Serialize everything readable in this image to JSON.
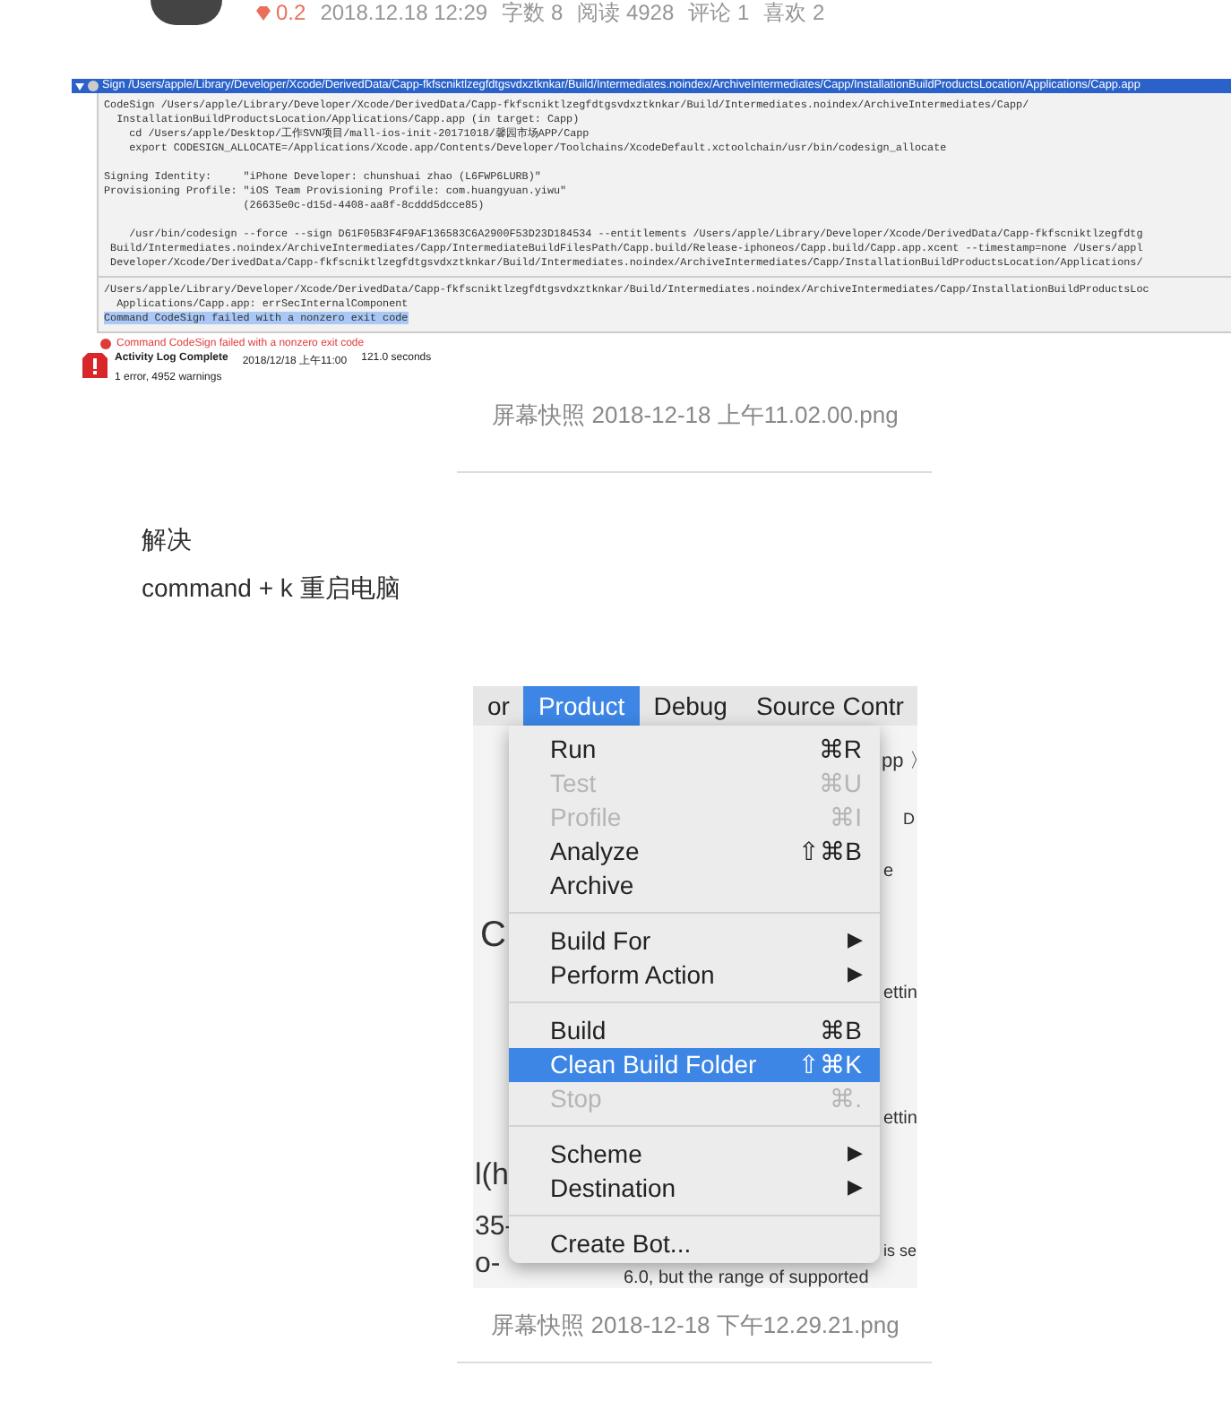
{
  "meta": {
    "score": "0.2",
    "date": "2018.12.18 12:29",
    "stats": [
      "字数 8",
      "阅读 4928",
      "评论 1",
      "喜欢 2"
    ]
  },
  "shot1": {
    "header": "Sign /Users/apple/Library/Developer/Xcode/DerivedData/Capp-fkfscniktlzegfdtgsvdxztknkar/Build/Intermediates.noindex/ArchiveIntermediates/Capp/InstallationBuildProductsLocation/Applications/Capp.app",
    "blocks": [
      [
        [
          "CodeSign /Users/apple/Library/Developer/Xcode/DerivedData/Capp-fkfscniktlzegfdtgsvdxztknkar/Build/Intermediates.noindex/ArchiveIntermediates/Capp/",
          "  InstallationBuildProductsLocation/Applications/Capp.app (in target: Capp)",
          "    cd /Users/apple/Desktop/工作SVN项目/mall-ios-init-20171018/馨园市场APP/Capp",
          "    export CODESIGN_ALLOCATE=/Applications/Xcode.app/Contents/Developer/Toolchains/XcodeDefault.xctoolchain/usr/bin/codesign_allocate"
        ],
        [
          "Signing Identity:     \"iPhone Developer: chunshuai zhao (L6FWP6LURB)\"",
          "Provisioning Profile: \"iOS Team Provisioning Profile: com.huangyuan.yiwu\"",
          "                      (26635e0c-d15d-4408-aa8f-8cddd5dcce85)"
        ],
        [
          "    /usr/bin/codesign --force --sign D61F05B3F4F9AF136583C6A2900F53D23D184534 --entitlements /Users/apple/Library/Developer/Xcode/DerivedData/Capp-fkfscniktlzegfdtg",
          " Build/Intermediates.noindex/ArchiveIntermediates/Capp/IntermediateBuildFilesPath/Capp.build/Release-iphoneos/Capp.build/Capp.app.xcent --timestamp=none /Users/appl",
          " Developer/Xcode/DerivedData/Capp-fkfscniktlzegfdtgsvdxztknkar/Build/Intermediates.noindex/ArchiveIntermediates/Capp/InstallationBuildProductsLocation/Applications/"
        ]
      ],
      [
        [
          "/Users/apple/Library/Developer/Xcode/DerivedData/Capp-fkfscniktlzegfdtgsvdxztknkar/Build/Intermediates.noindex/ArchiveIntermediates/Capp/InstallationBuildProductsLoc",
          "  Applications/Capp.app: errSecInternalComponent"
        ]
      ]
    ],
    "highlight": "Command CodeSign failed with a nonzero exit code",
    "error": "Command CodeSign failed with a nonzero exit code",
    "activity": {
      "title": "Activity Log Complete",
      "time": "2018/12/18 上午11:00",
      "duration": "121.0 seconds",
      "counts": "1 error, 4952 warnings"
    }
  },
  "caption1": "屏幕快照 2018-12-18 上午11.02.00.png",
  "solution": [
    "解决",
    "command + k 重启电脑"
  ],
  "shot2": {
    "menubar": [
      {
        "label": "or",
        "selected": false
      },
      {
        "label": "Product",
        "selected": true
      },
      {
        "label": "Debug",
        "selected": false
      },
      {
        "label": "Source Contr",
        "selected": false
      }
    ],
    "background": [
      "pp 〉",
      "D",
      "e",
      "C",
      "ettin",
      "ettin",
      "l(h",
      "35-",
      "o-",
      "is se",
      "6.0, but the range of supported"
    ],
    "menu": [
      {
        "kind": "item",
        "label": "Run",
        "shortcut": "⌘R",
        "disabled": false,
        "selected": false
      },
      {
        "kind": "item",
        "label": "Test",
        "shortcut": "⌘U",
        "disabled": true,
        "selected": false
      },
      {
        "kind": "item",
        "label": "Profile",
        "shortcut": "⌘I",
        "disabled": true,
        "selected": false
      },
      {
        "kind": "item",
        "label": "Analyze",
        "shortcut": "⇧⌘B",
        "disabled": false,
        "selected": false
      },
      {
        "kind": "item",
        "label": "Archive",
        "disabled": false,
        "selected": false
      },
      {
        "kind": "separator"
      },
      {
        "kind": "submenu",
        "label": "Build For",
        "arrow": "▶",
        "disabled": false,
        "selected": false
      },
      {
        "kind": "submenu",
        "label": "Perform Action",
        "arrow": "▶",
        "disabled": false,
        "selected": false
      },
      {
        "kind": "separator"
      },
      {
        "kind": "item",
        "label": "Build",
        "shortcut": "⌘B",
        "disabled": false,
        "selected": false
      },
      {
        "kind": "item",
        "label": "Clean Build Folder",
        "shortcut": "⇧⌘K",
        "disabled": false,
        "selected": true
      },
      {
        "kind": "item",
        "label": "Stop",
        "shortcut": "⌘.",
        "disabled": true,
        "selected": false
      },
      {
        "kind": "separator"
      },
      {
        "kind": "submenu",
        "label": "Scheme",
        "arrow": "▶",
        "disabled": false,
        "selected": false
      },
      {
        "kind": "submenu",
        "label": "Destination",
        "arrow": "▶",
        "disabled": false,
        "selected": false
      },
      {
        "kind": "separator"
      },
      {
        "kind": "item",
        "label": "Create Bot...",
        "disabled": false,
        "selected": false
      }
    ]
  },
  "caption2": "屏幕快照 2018-12-18 下午12.29.21.png"
}
